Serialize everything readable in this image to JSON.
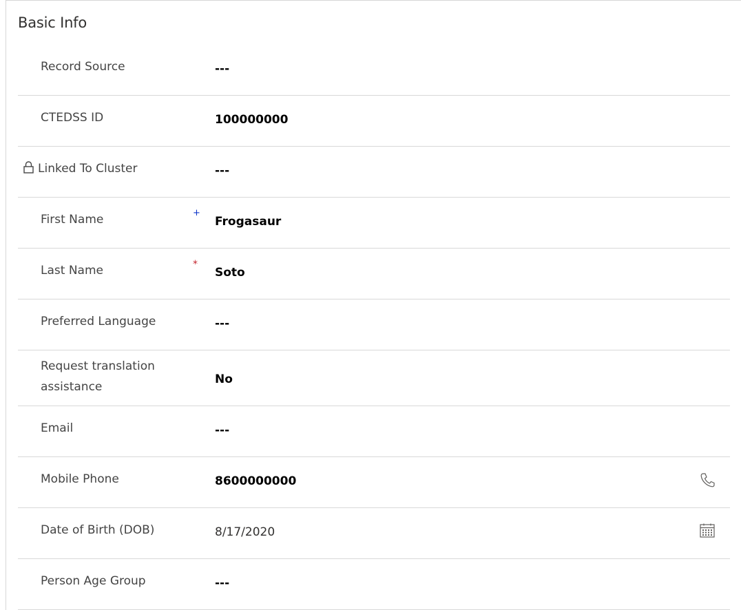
{
  "section": {
    "title": "Basic Info"
  },
  "fields": [
    {
      "label": "Record Source",
      "value": "---"
    },
    {
      "label": "CTEDSS ID",
      "value": "100000000"
    },
    {
      "label": "Linked To Cluster",
      "value": "---",
      "locked": true
    },
    {
      "label": "First Name",
      "value": "Frogasaur",
      "required_marker": "+"
    },
    {
      "label": "Last Name",
      "value": "Soto",
      "required_marker": "*"
    },
    {
      "label": "Preferred Language",
      "value": "---"
    },
    {
      "label": "Request translation assistance",
      "value": "No"
    },
    {
      "label": "Email",
      "value": "---"
    },
    {
      "label": "Mobile Phone",
      "value": "8600000000",
      "icon": "phone-icon"
    },
    {
      "label": "Date of Birth (DOB)",
      "value": "8/17/2020",
      "icon": "calendar-icon"
    },
    {
      "label": "Person Age Group",
      "value": "---"
    }
  ],
  "colors": {
    "recommended_marker": "#0b33c9",
    "required_marker": "#c4262e",
    "divider": "#d8d8d8"
  }
}
